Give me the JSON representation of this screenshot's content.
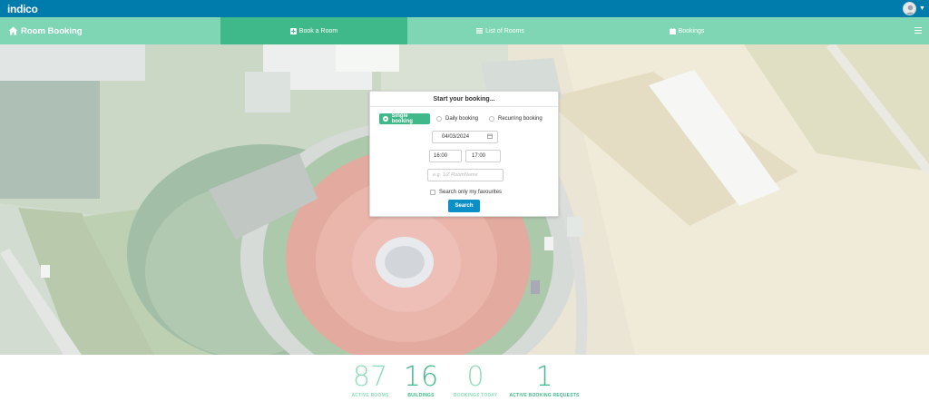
{
  "topbar": {
    "logo_text": "indico",
    "avatar_icon": "user-avatar",
    "accent_color": "#007cac"
  },
  "navbar": {
    "brand_label": "Room Booking",
    "tabs": [
      {
        "label": "Book a Room",
        "icon": "plus-square-icon",
        "active": true
      },
      {
        "label": "List of Rooms",
        "icon": "list-icon",
        "active": false
      },
      {
        "label": "Bookings",
        "icon": "calendar-icon",
        "active": false
      }
    ],
    "menu_icon": "hamburger-icon",
    "nav_color": "#7fd6b4",
    "active_color": "#3fb98a"
  },
  "booking_panel": {
    "title": "Start your booking...",
    "options": [
      {
        "label": "Single booking",
        "selected": true
      },
      {
        "label": "Daily booking",
        "selected": false
      },
      {
        "label": "Recurring booking",
        "selected": false
      }
    ],
    "date_value": "04/03/2024",
    "time_start": "16:00",
    "time_end": "17:00",
    "room_placeholder": "e.g. 1/Z RoomName",
    "favourites_label": "Search only my favourites",
    "favourites_checked": false,
    "search_button": "Search"
  },
  "stats": [
    {
      "value": "87",
      "label": "ACTIVE ROOMS"
    },
    {
      "value": "16",
      "label": "BUILDINGS"
    },
    {
      "value": "0",
      "label": "BOOKINGS TODAY"
    },
    {
      "value": "1",
      "label": "ACTIVE BOOKING REQUESTS"
    }
  ]
}
